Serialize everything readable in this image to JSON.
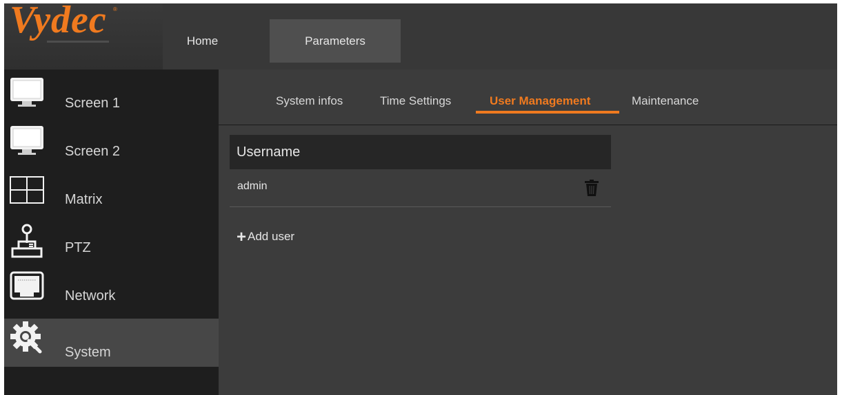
{
  "header": {
    "logo_text": "Vydec",
    "logo_reg": "®",
    "nav": {
      "home": "Home",
      "parameters": "Parameters"
    }
  },
  "sidebar": {
    "items": [
      {
        "label": "Screen 1",
        "icon": "monitor-icon"
      },
      {
        "label": "Screen 2",
        "icon": "monitor-icon"
      },
      {
        "label": "Matrix",
        "icon": "grid-icon"
      },
      {
        "label": "PTZ",
        "icon": "joystick-icon"
      },
      {
        "label": "Network",
        "icon": "ethernet-port-icon"
      },
      {
        "label": "System",
        "icon": "gear-wrench-icon"
      }
    ],
    "active": "System"
  },
  "main": {
    "tabs": [
      "System infos",
      "Time Settings",
      "User Management",
      "Maintenance"
    ],
    "active_tab": "User Management",
    "table": {
      "header": "Username",
      "rows": [
        {
          "username": "admin"
        }
      ]
    },
    "add_user_label": "Add user"
  },
  "colors": {
    "accent": "#f07a1f",
    "sidebar_bg": "#1e1e1e",
    "main_bg": "#3c3c3c",
    "header_bg": "#383838"
  }
}
